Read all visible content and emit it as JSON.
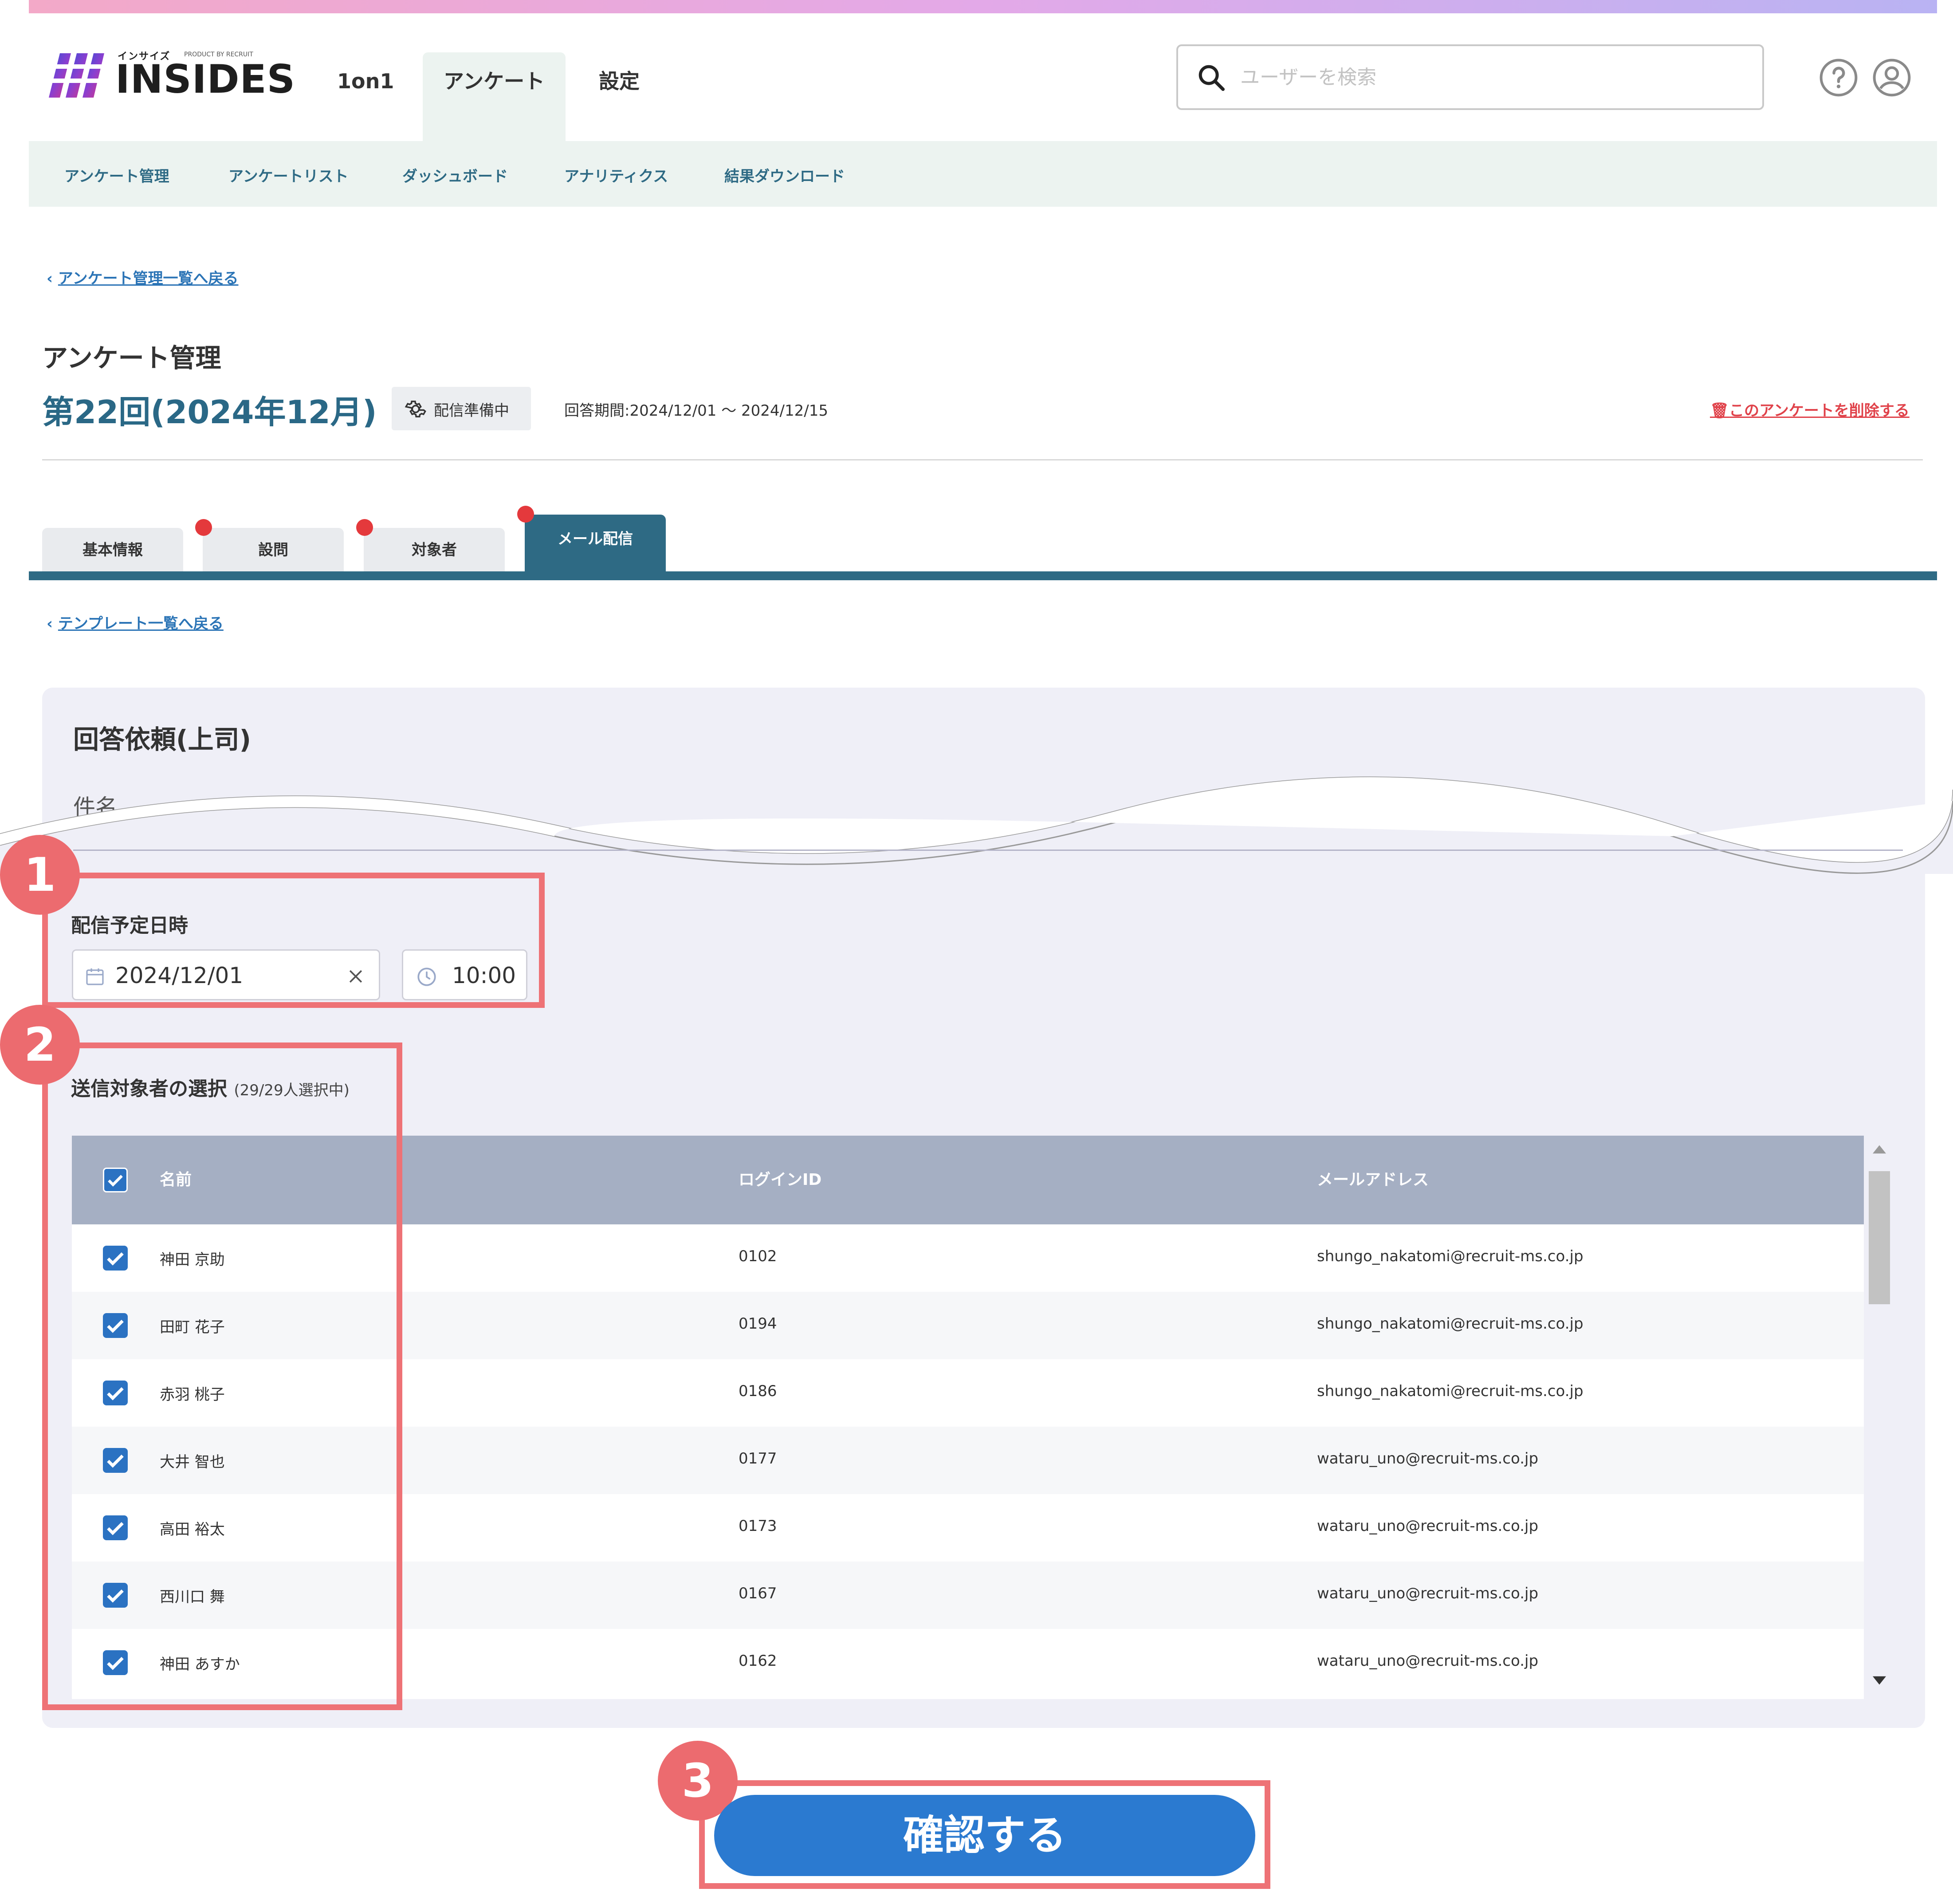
{
  "brand": {
    "name": "INSIDES",
    "kana": "インサイズ",
    "product_by": "PRODUCT BY RECRUIT"
  },
  "nav": {
    "items": [
      "1on1",
      "アンケート",
      "設定"
    ],
    "active": "アンケート"
  },
  "search": {
    "placeholder": "ユーザーを検索"
  },
  "header_icons": [
    "help-icon",
    "account-icon"
  ],
  "subnav": {
    "items": [
      "アンケート管理",
      "アンケートリスト",
      "ダッシュボード",
      "アナリティクス",
      "結果ダウンロード"
    ]
  },
  "breadcrumb": {
    "back_label": "アンケート管理一覧へ戻る"
  },
  "page": {
    "title": "アンケート管理",
    "survey_name": "第22回(2024年12月)",
    "status": "配信準備中",
    "period": "回答期間:2024/12/01 〜 2024/12/15",
    "delete_label": "このアンケートを削除する"
  },
  "tabs": [
    {
      "label": "基本情報",
      "dot": false
    },
    {
      "label": "設問",
      "dot": true
    },
    {
      "label": "対象者",
      "dot": true
    },
    {
      "label": "メール配信",
      "dot": true,
      "active": true
    }
  ],
  "template_back": "テンプレート一覧へ戻る",
  "mail": {
    "section_title": "回答依頼(上司)",
    "subject_label": "件名",
    "schedule_label": "配信予定日時",
    "date_value": "2024/12/01",
    "time_value": "10:00",
    "recipients_label": "送信対象者の選択",
    "recipients_count": "(29/29人選択中)"
  },
  "table": {
    "headers": [
      "名前",
      "ログインID",
      "メールアドレス"
    ],
    "rows": [
      {
        "name": "神田 京助",
        "login_id": "0102",
        "email": "shungo_nakatomi@recruit-ms.co.jp",
        "checked": true
      },
      {
        "name": "田町 花子",
        "login_id": "0194",
        "email": "shungo_nakatomi@recruit-ms.co.jp",
        "checked": true
      },
      {
        "name": "赤羽 桃子",
        "login_id": "0186",
        "email": "shungo_nakatomi@recruit-ms.co.jp",
        "checked": true
      },
      {
        "name": "大井 智也",
        "login_id": "0177",
        "email": "wataru_uno@recruit-ms.co.jp",
        "checked": true
      },
      {
        "name": "高田 裕太",
        "login_id": "0173",
        "email": "wataru_uno@recruit-ms.co.jp",
        "checked": true
      },
      {
        "name": "西川口 舞",
        "login_id": "0167",
        "email": "wataru_uno@recruit-ms.co.jp",
        "checked": true
      },
      {
        "name": "神田 あすか",
        "login_id": "0162",
        "email": "wataru_uno@recruit-ms.co.jp",
        "checked": true
      }
    ]
  },
  "annotations": [
    "1",
    "2",
    "3"
  ],
  "confirm_label": "確認する",
  "colors": {
    "accent": "#2e6a84",
    "primary_button": "#2b7ad0",
    "annotation": "#ec6b6f",
    "alert": "#e4393c"
  }
}
